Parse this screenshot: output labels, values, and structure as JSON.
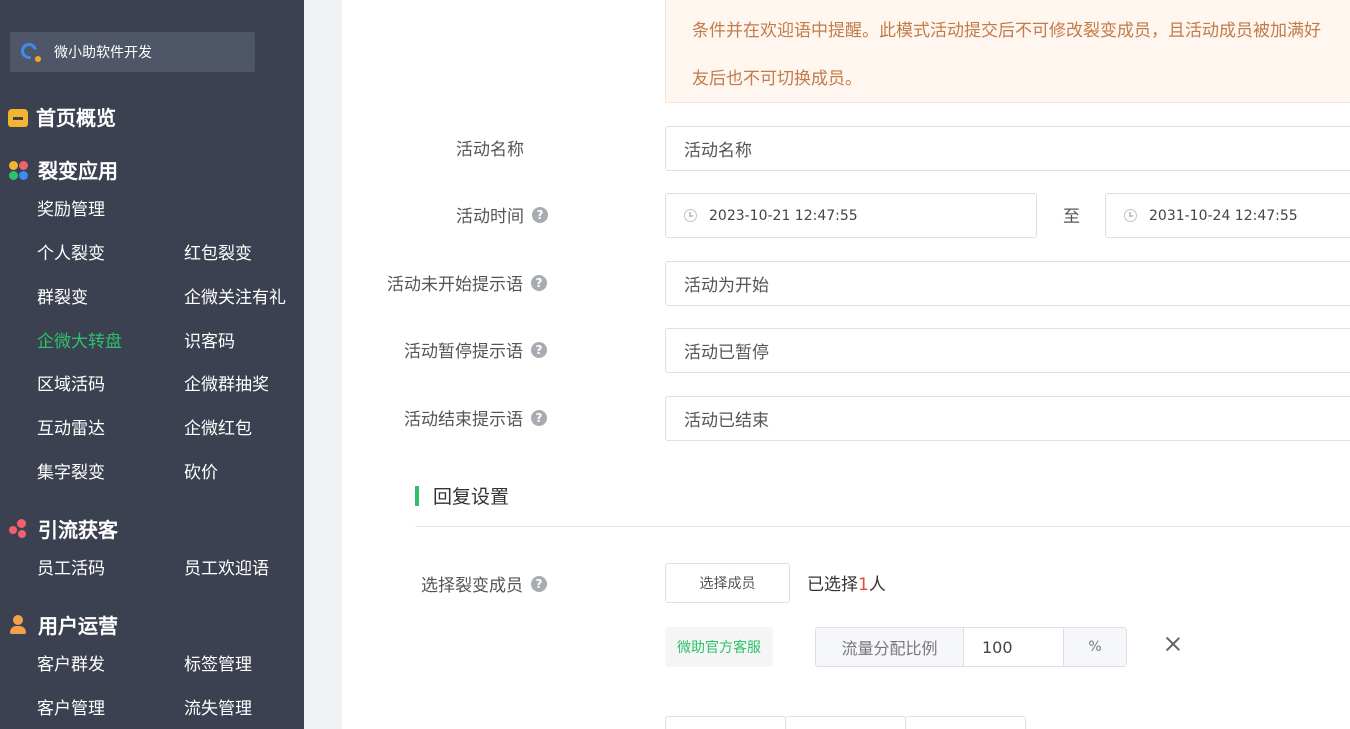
{
  "sidebar": {
    "brand": {
      "name": "微小助软件开发",
      "icon": "logo-icon"
    },
    "sections": {
      "home": {
        "title": "首页概览",
        "icon": "home-icon"
      },
      "fission": {
        "title": "裂变应用",
        "icon": "apps-icon",
        "items": [
          "奖励管理",
          "个人裂变",
          "红包裂变",
          "群裂变",
          "企微关注有礼",
          "企微大转盘",
          "识客码",
          "区域活码",
          "企微群抽奖",
          "互动雷达",
          "企微红包",
          "集字裂变",
          "砍价"
        ]
      },
      "traffic": {
        "title": "引流获客",
        "icon": "share-icon",
        "items": [
          "员工活码",
          "员工欢迎语"
        ]
      },
      "users": {
        "title": "用户运营",
        "icon": "user-icon",
        "items": [
          "客户群发",
          "标签管理",
          "客户管理",
          "流失管理"
        ]
      }
    },
    "active_item": "企微大转盘",
    "active_color": "#2ec06b"
  },
  "form": {
    "notice": {
      "line1": "条件并在欢迎语中提醒。此模式活动提交后不可修改裂变成员，且活动成员被加满好",
      "line2": "友后也不可切换成员。"
    },
    "activity_name": {
      "label": "活动名称",
      "value": "活动名称"
    },
    "activity_time": {
      "label": "活动时间",
      "start": "2023-10-21 12:47:55",
      "separator": "至",
      "end": "2031-10-24 12:47:55"
    },
    "not_started_tip": {
      "label": "活动未开始提示语",
      "value": "活动为开始"
    },
    "paused_tip": {
      "label": "活动暂停提示语",
      "value": "活动已暂停"
    },
    "ended_tip": {
      "label": "活动结束提示语",
      "value": "活动已结束"
    },
    "reply_section": {
      "title": "回复设置"
    },
    "fission_member": {
      "label": "选择裂变成员",
      "button": "选择成员",
      "selected_prefix": "已选择",
      "selected_count": "1",
      "selected_suffix": "人",
      "member_name": "微助官方客服",
      "ratio_label": "流量分配比例",
      "ratio_value": "100",
      "ratio_unit": "%"
    }
  },
  "colors": {
    "accent": "#2ec06b",
    "sidebar_bg": "#3b4150",
    "notice_text": "#c27c4a",
    "count_red": "#e64a3b"
  }
}
